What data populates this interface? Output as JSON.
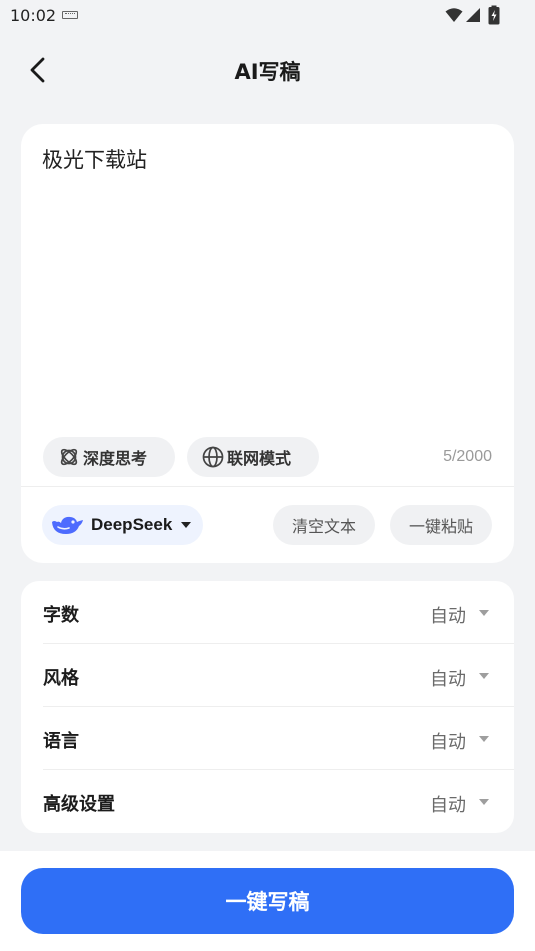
{
  "status_bar": {
    "time": "10:02"
  },
  "header": {
    "title": "AI写稿"
  },
  "editor": {
    "text": "极光下载站",
    "char_count": "5/2000",
    "chips": {
      "deep_thinking": "深度思考",
      "web_mode": "联网模式"
    },
    "model": "DeepSeek",
    "clear_label": "清空文本",
    "paste_label": "一键粘贴"
  },
  "settings": {
    "word_count": {
      "label": "字数",
      "value": "自动"
    },
    "style": {
      "label": "风格",
      "value": "自动"
    },
    "language": {
      "label": "语言",
      "value": "自动"
    },
    "advanced": {
      "label": "高级设置",
      "value": "自动"
    }
  },
  "submit_label": "一键写稿",
  "colors": {
    "primary": "#2f6ff6",
    "background": "#f2f3f5",
    "model_chip": "#eef3fe",
    "deepseek_logo": "#4d6bfe"
  }
}
